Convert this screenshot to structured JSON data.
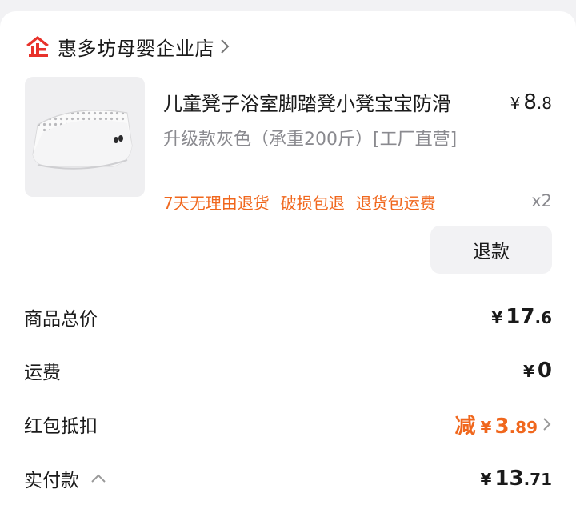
{
  "shop": {
    "name": "惠多坊母婴企业店",
    "logo_text": "企",
    "logo_color": "#e8322b",
    "chevron_icon": "chevron-right-icon"
  },
  "product": {
    "image_icon": "step-stool-photo",
    "title": "儿童凳子浴室脚踏凳小凳宝宝防滑",
    "price_symbol": "¥",
    "price_int": "8",
    "price_dec": ".8",
    "spec": "升级款灰色（承重200斤）[工厂直营]",
    "services": [
      "7天无理由退货",
      "破损包退",
      "退货包运费"
    ],
    "quantity": "x2",
    "refund_label": "退款"
  },
  "summary": {
    "goods_total": {
      "label": "商品总价",
      "symbol": "¥",
      "int": "17",
      "dec": ".6"
    },
    "shipping": {
      "label": "运费",
      "symbol": "¥",
      "int": "0",
      "dec": ""
    },
    "coupon": {
      "label": "红包抵扣",
      "prefix": "减",
      "symbol": "¥",
      "int": "3",
      "dec": ".89"
    },
    "paid": {
      "label": "实付款",
      "symbol": "¥",
      "int": "13",
      "dec": ".71",
      "toggle_icon": "chevron-up-icon"
    }
  },
  "colors": {
    "accent_orange": "#f0671d",
    "muted_text": "#8a8a8f",
    "background": "#f2f2f4"
  }
}
